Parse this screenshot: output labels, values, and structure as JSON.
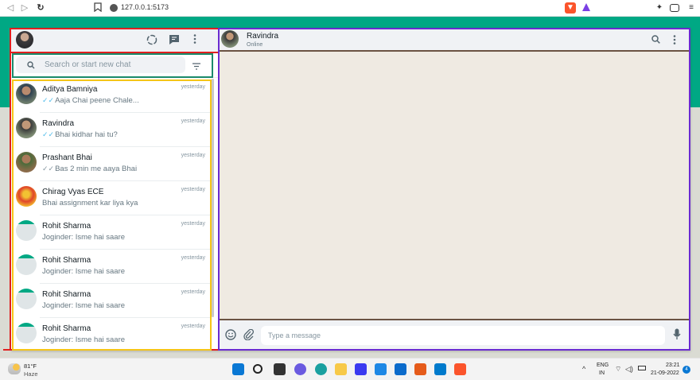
{
  "browser": {
    "url": "127.0.0.1:5173"
  },
  "left_panel": {
    "search_placeholder": "Search or start new chat",
    "chats": [
      {
        "name": "Aditya Bamniya",
        "time": "yesterday",
        "message": "Aaja Chai peene Chale...",
        "tick": "blue"
      },
      {
        "name": "Ravindra",
        "time": "yesterday",
        "message": "Bhai kidhar hai tu?",
        "tick": "blue"
      },
      {
        "name": "Prashant Bhai",
        "time": "yesterday",
        "message": "Bas 2 min me aaya Bhai",
        "tick": "grey"
      },
      {
        "name": "Chirag Vyas ECE",
        "time": "yesterday",
        "message": "Bhai assignment kar liya kya",
        "tick": "none"
      },
      {
        "name": "Rohit Sharma",
        "time": "yesterday",
        "message": "Joginder: Isme hai saare",
        "tick": "none"
      },
      {
        "name": "Rohit Sharma",
        "time": "yesterday",
        "message": "Joginder: Isme hai saare",
        "tick": "none"
      },
      {
        "name": "Rohit Sharma",
        "time": "yesterday",
        "message": "Joginder: Isme hai saare",
        "tick": "none"
      },
      {
        "name": "Rohit Sharma",
        "time": "yesterday",
        "message": "Joginder: Isme hai saare",
        "tick": "none"
      }
    ]
  },
  "right_panel": {
    "contact_name": "Ravindra",
    "contact_status": "Online",
    "message_placeholder": "Type a message"
  },
  "taskbar": {
    "weather_temp": "81°F",
    "weather_desc": "Haze",
    "lang_line1": "ENG",
    "lang_line2": "IN",
    "time": "23:21",
    "date": "21-09-2022",
    "notification_count": "4"
  },
  "colors": {
    "brand_green": "#00a884",
    "panel_header": "#f0f2f5",
    "chat_bg": "#efeae2",
    "box_red": "#e02020",
    "box_teal": "#1b8a6b",
    "box_yellow": "#f5c518",
    "box_purple": "#6a2bd1"
  }
}
